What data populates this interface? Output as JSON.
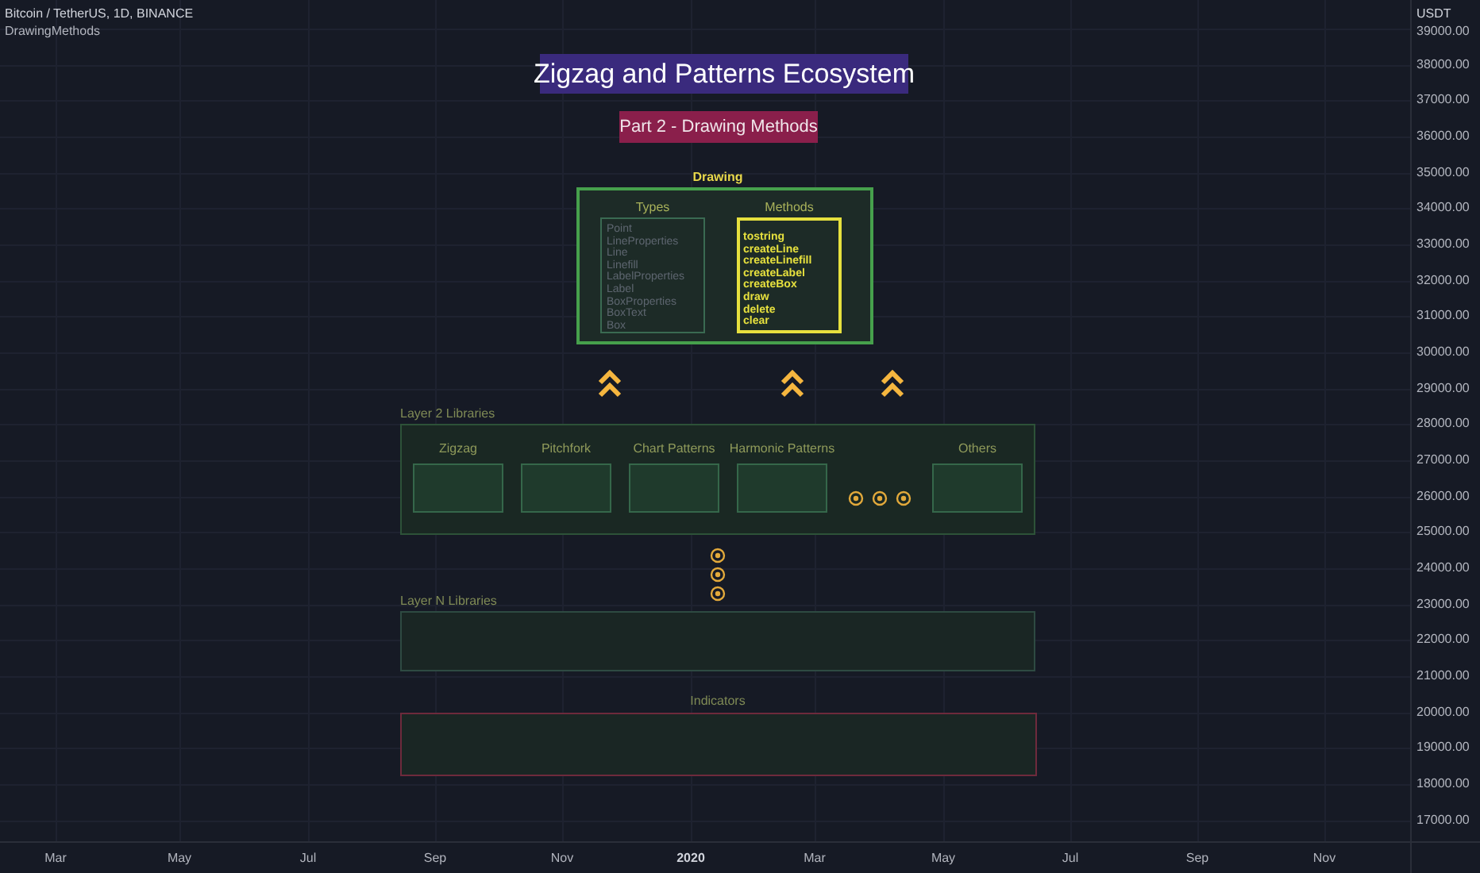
{
  "header": {
    "symbol": "Bitcoin / TetherUS, 1D, BINANCE",
    "indicator": "DrawingMethods"
  },
  "title": "Zigzag and Patterns Ecosystem",
  "subtitle": "Part 2 - Drawing Methods",
  "drawing": {
    "title": "Drawing",
    "types_title": "Types",
    "types": [
      "Point",
      "LineProperties",
      "Line",
      "Linefill",
      "LabelProperties",
      "Label",
      "BoxProperties",
      "BoxText",
      "Box"
    ],
    "methods_title": "Methods",
    "methods": [
      "tostring",
      "createLine",
      "createLinefill",
      "createLabel",
      "createBox",
      "draw",
      "delete",
      "clear"
    ]
  },
  "layer2": {
    "title": "Layer 2 Libraries",
    "items": [
      {
        "kind": "library",
        "name": "Zigzag"
      },
      {
        "kind": "library",
        "name": "Pitchfork"
      },
      {
        "kind": "library",
        "name": "Chart Patterns"
      },
      {
        "kind": "library",
        "name": "Harmonic Patterns"
      },
      {
        "kind": "more"
      },
      {
        "kind": "library",
        "name": "Others"
      }
    ]
  },
  "layerN": {
    "title": "Layer N Libraries"
  },
  "indicators": {
    "title": "Indicators"
  },
  "price_axis": {
    "unit": "USDT",
    "ticks": [
      "39000.00",
      "38000.00",
      "37000.00",
      "36000.00",
      "35000.00",
      "34000.00",
      "33000.00",
      "32000.00",
      "31000.00",
      "30000.00",
      "29000.00",
      "28000.00",
      "27000.00",
      "26000.00",
      "25000.00",
      "24000.00",
      "23000.00",
      "22000.00",
      "21000.00",
      "20000.00",
      "19000.00",
      "18000.00",
      "17000.00"
    ]
  },
  "time_axis": {
    "ticks": [
      {
        "label": "Mar",
        "kind": "month"
      },
      {
        "label": "May",
        "kind": "month"
      },
      {
        "label": "Jul",
        "kind": "month"
      },
      {
        "label": "Sep",
        "kind": "month"
      },
      {
        "label": "Nov",
        "kind": "month"
      },
      {
        "label": "2020",
        "kind": "year"
      },
      {
        "label": "Mar",
        "kind": "month"
      },
      {
        "label": "May",
        "kind": "month"
      },
      {
        "label": "Jul",
        "kind": "month"
      },
      {
        "label": "Sep",
        "kind": "month"
      },
      {
        "label": "Nov",
        "kind": "month"
      }
    ]
  }
}
